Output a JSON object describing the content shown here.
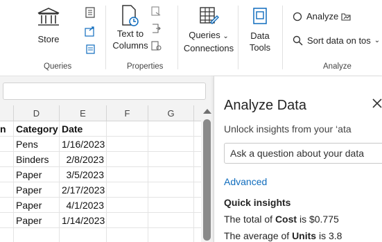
{
  "ribbon": {
    "groups": {
      "queries": {
        "label": "Queries",
        "store_label": "Store"
      },
      "properties": {
        "label": "Properties",
        "text_to_columns_line1": "Text to",
        "text_to_columns_line2": "Columns"
      },
      "connections": {
        "queries_line1": "Queries",
        "queries_line2": "Connections",
        "data_tools_line1": "Data",
        "data_tools_line2": "Tools"
      },
      "analyze": {
        "label": "Analyze",
        "analyze_label": "Analyze",
        "sort_label": "Sort data on tos"
      }
    },
    "icons": {
      "store": "bank-store-icon",
      "text_to_columns": "text-to-columns-icon",
      "queries_connections": "table-edit-icon",
      "data_tools": "data-tools-icon",
      "analyze": "lightbulb-icon",
      "sort": "search-icon"
    }
  },
  "grid": {
    "columns": [
      "D",
      "E",
      "F",
      "G"
    ],
    "rows": [
      {
        "c": "n",
        "d": "Category",
        "e": "Date",
        "bold": true
      },
      {
        "c": "",
        "d": "Pens",
        "e": "1/16/2023",
        "bold": false
      },
      {
        "c": "",
        "d": "Binders",
        "e": "2/8/2023",
        "bold": false
      },
      {
        "c": "",
        "d": "Paper",
        "e": "3/5/2023",
        "bold": false
      },
      {
        "c": "",
        "d": "Paper",
        "e": "2/17/2023",
        "bold": false
      },
      {
        "c": "",
        "d": "Paper",
        "e": "4/1/2023",
        "bold": false
      },
      {
        "c": "",
        "d": "Paper",
        "e": "1/14/2023",
        "bold": false
      }
    ]
  },
  "pane": {
    "title": "Analyze Data",
    "subtitle": "Unlock insights from your ‘ata",
    "ask_placeholder": "Ask a question about your data",
    "advanced": "Advanced",
    "quick_insights": "Quick insights",
    "insights": [
      {
        "prefix": "The total of ",
        "field": "Cost",
        "suffix": " is  $0.775"
      },
      {
        "prefix": "The average of ",
        "field": "Units",
        "suffix": " is  3.8"
      }
    ]
  },
  "colors": {
    "accent": "#0f6cbd",
    "ribbon_bg": "#ffffff",
    "header_bg": "#f3f3f3"
  }
}
